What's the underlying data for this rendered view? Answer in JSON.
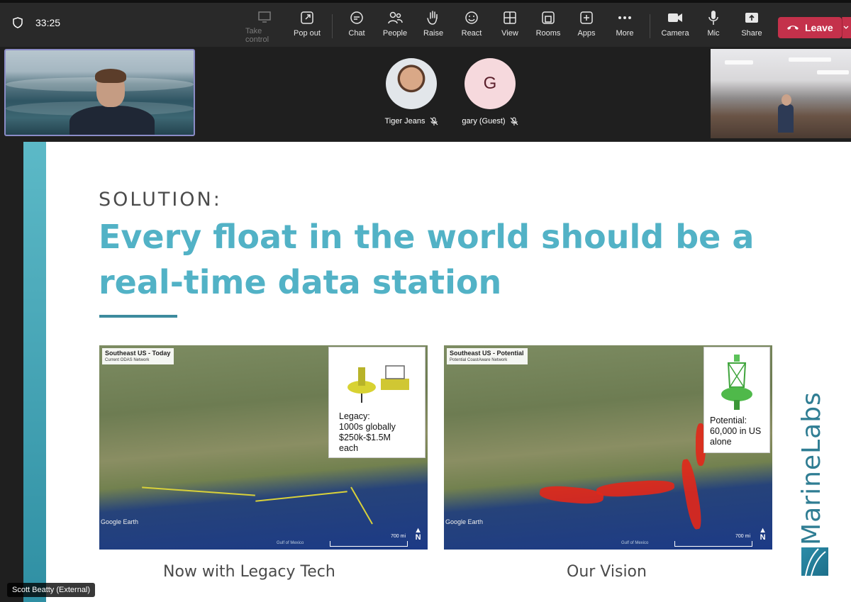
{
  "toolbar": {
    "timer": "33:25",
    "buttons": [
      {
        "label": "Take control",
        "icon": "take-control-icon",
        "disabled": true
      },
      {
        "label": "Pop out",
        "icon": "pop-out-icon"
      },
      {
        "label": "Chat",
        "icon": "chat-icon"
      },
      {
        "label": "People",
        "icon": "people-icon"
      },
      {
        "label": "Raise",
        "icon": "raise-hand-icon"
      },
      {
        "label": "React",
        "icon": "react-icon"
      },
      {
        "label": "View",
        "icon": "view-icon"
      },
      {
        "label": "Rooms",
        "icon": "rooms-icon"
      },
      {
        "label": "Apps",
        "icon": "apps-icon"
      },
      {
        "label": "More",
        "icon": "more-icon"
      },
      {
        "label": "Camera",
        "icon": "camera-icon"
      },
      {
        "label": "Mic",
        "icon": "mic-icon"
      },
      {
        "label": "Share",
        "icon": "share-icon"
      }
    ],
    "leave_label": "Leave",
    "leave_color": "#c4314b"
  },
  "participants": [
    {
      "name": "Tiger Jeans",
      "avatar": "photo",
      "muted": true
    },
    {
      "name": "gary (Guest)",
      "avatar_initial": "G",
      "muted": true
    }
  ],
  "slide": {
    "kicker": "SOLUTION:",
    "headline": "Every float in the world should be a real-time data station",
    "accent_color": "#52b2c6",
    "left_map": {
      "label_title": "Southeast US - Today",
      "label_sub": "Current ODAS Network",
      "card": [
        "Legacy:",
        "1000s globally",
        "$250k-$1.5M",
        "each"
      ],
      "google_earth": "Google Earth",
      "scale": "700 mi",
      "north": "N",
      "gulf": "Gulf of Mexico",
      "caption": "Now with Legacy Tech"
    },
    "right_map": {
      "label_title": "Southeast US - Potential",
      "label_sub": "Potential CoastAware Network",
      "card": [
        "Potential:",
        "60,000 in US",
        "alone"
      ],
      "google_earth": "Google Earth",
      "scale": "700 mi",
      "north": "N",
      "gulf": "Gulf of Mexico",
      "caption": "Our Vision"
    },
    "brand": "MarineLabs"
  },
  "speaker_tag": "Scott Beatty (External)"
}
